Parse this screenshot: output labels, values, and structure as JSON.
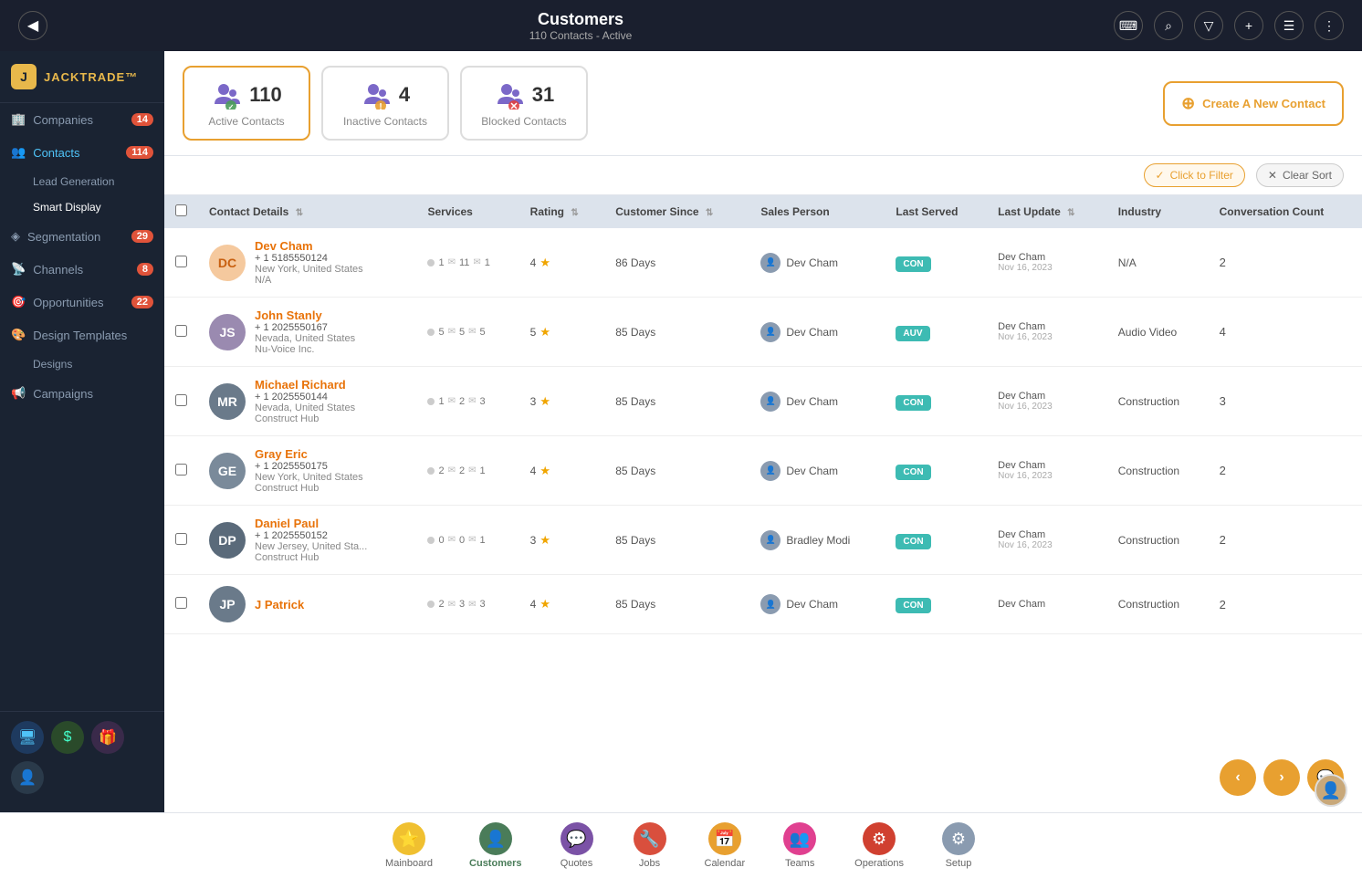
{
  "header": {
    "title": "Customers",
    "subtitle": "110 Contacts - Active",
    "back_label": "‹"
  },
  "header_icons": [
    "⌨",
    "⌕",
    "⚗",
    "+",
    "☰",
    "⋮"
  ],
  "sidebar": {
    "logo_text": "JACKTRADE™",
    "items": [
      {
        "id": "companies",
        "label": "Companies",
        "icon": "🏢",
        "badge": "14"
      },
      {
        "id": "contacts",
        "label": "Contacts",
        "icon": "👥",
        "badge": "114",
        "active": true
      },
      {
        "id": "lead-gen",
        "label": "Lead Generation",
        "icon": "⚡",
        "sub": true
      },
      {
        "id": "smart-display",
        "label": "Smart Display",
        "icon": "",
        "sub": true
      },
      {
        "id": "segmentation",
        "label": "Segmentation",
        "icon": "◈",
        "badge": "29"
      },
      {
        "id": "channels",
        "label": "Channels",
        "icon": "📡",
        "badge": "8"
      },
      {
        "id": "opportunities",
        "label": "Opportunities",
        "icon": "🎯",
        "badge": "22"
      },
      {
        "id": "design-templates",
        "label": "Design Templates",
        "icon": "🎨",
        "sub": false
      },
      {
        "id": "designs",
        "label": "Designs",
        "icon": "",
        "sub": true
      },
      {
        "id": "campaigns",
        "label": "Campaigns",
        "icon": "📢"
      }
    ]
  },
  "stats": {
    "active": {
      "number": "110",
      "label": "Active Contacts",
      "color": "#e8a030"
    },
    "inactive": {
      "number": "4",
      "label": "Inactive Contacts",
      "color": "#e8a030"
    },
    "blocked": {
      "number": "31",
      "label": "Blocked Contacts",
      "color": "#e04040"
    }
  },
  "create_btn": "Create A New Contact",
  "filter_btn": "Click to Filter",
  "clear_sort_btn": "Clear Sort",
  "table": {
    "headers": [
      "Contact Details",
      "Services",
      "Rating",
      "Customer Since",
      "Sales Person",
      "Last Served",
      "Last Update",
      "Industry",
      "Conversation Count"
    ],
    "rows": [
      {
        "id": "dc",
        "initials": "DC",
        "avatar_bg": "#f5c99e",
        "name": "Dev Cham",
        "phone": "+ 1 5185550124",
        "location": "New York, United States",
        "company": "N/A",
        "services": "1  11  1",
        "rating": 4,
        "customer_since": "86 Days",
        "sales_person": "Dev Cham",
        "last_served_tag": "CON",
        "tag_color": "con",
        "last_update_by": "Dev Cham",
        "last_update_date": "Nov 16, 2023",
        "industry": "N/A",
        "conv_count": "2"
      },
      {
        "id": "js",
        "initials": "JS",
        "avatar_img": true,
        "avatar_color": "#7b6fa0",
        "name": "John Stanly",
        "phone": "+ 1 2025550167",
        "location": "Nevada, United States",
        "company": "Nu-Voice Inc.",
        "services": "5  5  5",
        "rating": 5,
        "customer_since": "85 Days",
        "sales_person": "Dev Cham",
        "last_served_tag": "AUV",
        "tag_color": "auv",
        "last_update_by": "Dev Cham",
        "last_update_date": "Nov 16, 2023",
        "industry": "Audio Video",
        "conv_count": "4"
      },
      {
        "id": "mr",
        "initials": "MR",
        "avatar_color": "#5a6a7a",
        "name": "Michael Richard",
        "phone": "+ 1 2025550144",
        "location": "Nevada, United States",
        "company": "Construct Hub",
        "services": "1  2  3",
        "rating": 3,
        "customer_since": "85 Days",
        "sales_person": "Dev Cham",
        "last_served_tag": "CON",
        "tag_color": "con",
        "last_update_by": "Dev Cham",
        "last_update_date": "Nov 16, 2023",
        "industry": "Construction",
        "conv_count": "3"
      },
      {
        "id": "ge",
        "initials": "GE",
        "avatar_color": "#6a7a8a",
        "name": "Gray Eric",
        "phone": "+ 1 2025550175",
        "location": "New York, United States",
        "company": "Construct Hub",
        "services": "2  2  1",
        "rating": 4,
        "customer_since": "85 Days",
        "sales_person": "Dev Cham",
        "last_served_tag": "CON",
        "tag_color": "con",
        "last_update_by": "Dev Cham",
        "last_update_date": "Nov 16, 2023",
        "industry": "Construction",
        "conv_count": "2"
      },
      {
        "id": "dp",
        "initials": "DP",
        "avatar_color": "#4a5a6a",
        "name": "Daniel Paul",
        "phone": "+ 1 2025550152",
        "location": "New Jersey, United Sta...",
        "company": "Construct Hub",
        "services": "0  0  1",
        "rating": 3,
        "customer_since": "85 Days",
        "sales_person": "Bradley Modi",
        "last_served_tag": "CON",
        "tag_color": "con",
        "last_update_by": "Dev Cham",
        "last_update_date": "Nov 16, 2023",
        "industry": "Construction",
        "conv_count": "2"
      },
      {
        "id": "jp",
        "initials": "JP",
        "avatar_color": "#5a6a7a",
        "name": "J Patrick",
        "phone": "",
        "location": "",
        "company": "",
        "services": "2  3  3",
        "rating": 4,
        "customer_since": "85 Days",
        "sales_person": "Dev Cham",
        "last_served_tag": "CON",
        "tag_color": "con",
        "last_update_by": "Dev Cham",
        "last_update_date": "",
        "industry": "Construction",
        "conv_count": "2"
      }
    ]
  },
  "bottom_nav": {
    "items": [
      {
        "id": "mainboard",
        "label": "Mainboard",
        "icon": "⭐",
        "color": "#f0c030"
      },
      {
        "id": "customers",
        "label": "Customers",
        "icon": "👤",
        "color": "#4a7c59",
        "active": true
      },
      {
        "id": "quotes",
        "label": "Quotes",
        "icon": "💬",
        "color": "#7b52a6"
      },
      {
        "id": "jobs",
        "label": "Jobs",
        "icon": "🔧",
        "color": "#d94f3d"
      },
      {
        "id": "calendar",
        "label": "Calendar",
        "icon": "📅",
        "color": "#e8a030"
      },
      {
        "id": "teams",
        "label": "Teams",
        "icon": "👥",
        "color": "#e04090"
      },
      {
        "id": "operations",
        "label": "Operations",
        "icon": "⚙",
        "color": "#d04030"
      },
      {
        "id": "setup",
        "label": "Setup",
        "icon": "⚙",
        "color": "#8a9bb0"
      }
    ]
  },
  "floating": {
    "prev": "‹",
    "next": "›",
    "chat": "💬"
  }
}
